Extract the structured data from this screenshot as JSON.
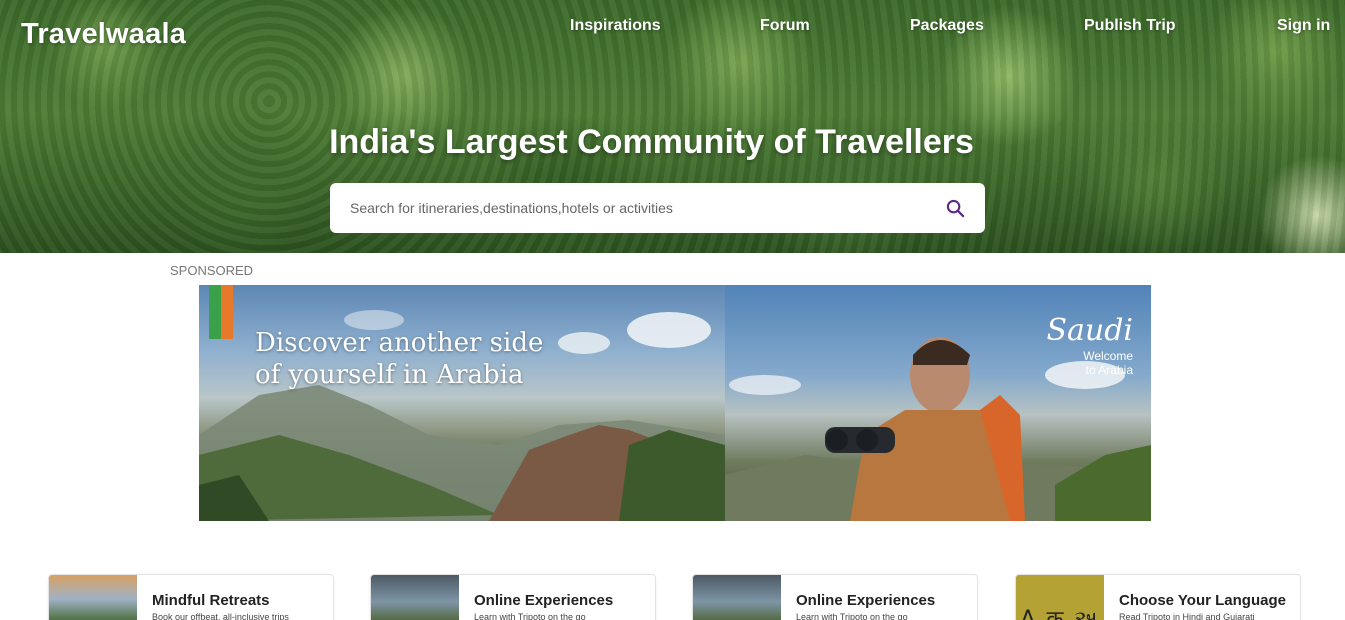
{
  "header": {
    "logo": "Travelwaala",
    "nav": [
      "Inspirations",
      "Forum",
      "Packages",
      "Publish Trip",
      "Sign in"
    ]
  },
  "hero": {
    "headline": "India's Largest Community of Travellers",
    "search": {
      "placeholder": "Search for itineraries,destinations,hotels or activities",
      "value": "",
      "icon": "search-icon"
    }
  },
  "sponsored": {
    "label": "SPONSORED",
    "ad": {
      "tagline_line1": "Discover another side",
      "tagline_line2": "of yourself in Arabia",
      "brand": "Saudi",
      "brand_sub1": "Welcome",
      "brand_sub2": "to Arabia"
    }
  },
  "categories": [
    {
      "title": "Mindful Retreats",
      "subtitle": "Book our offbeat, all-inclusive trips"
    },
    {
      "title": "Online Experiences",
      "subtitle": "Learn with Tripoto on the go"
    },
    {
      "title": "Online Experiences",
      "subtitle": "Learn with Tripoto on the go"
    },
    {
      "title": "Choose Your Language",
      "subtitle": "Read Tripoto in Hindi and Gujarati",
      "thumb_text": "A क અ"
    }
  ],
  "colors": {
    "search_icon": "#5b2a86",
    "flag_green": "#3aa04a",
    "flag_orange": "#e77a2a",
    "language_tile": "#b4a334"
  }
}
